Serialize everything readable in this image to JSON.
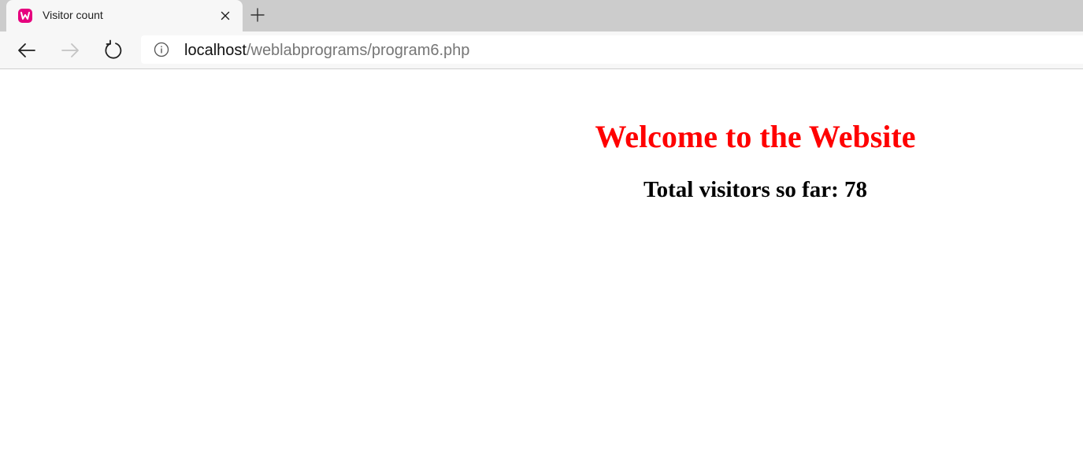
{
  "tab": {
    "title": "Visitor count",
    "favicon": "wamp-icon",
    "close_icon": "close-icon",
    "new_tab_icon": "plus-icon"
  },
  "toolbar": {
    "back_icon": "arrow-left-icon",
    "forward_icon": "arrow-right-icon",
    "reload_icon": "reload-icon",
    "info_icon": "info-icon"
  },
  "address": {
    "host": "localhost",
    "path": "/weblabprograms/program6.php"
  },
  "page": {
    "heading": "Welcome to the Website",
    "visitors_text": "Total visitors so far: 78"
  },
  "colors": {
    "heading": "#ff0000",
    "favicon": "#e6007e",
    "tabstrip": "#cccccc"
  }
}
